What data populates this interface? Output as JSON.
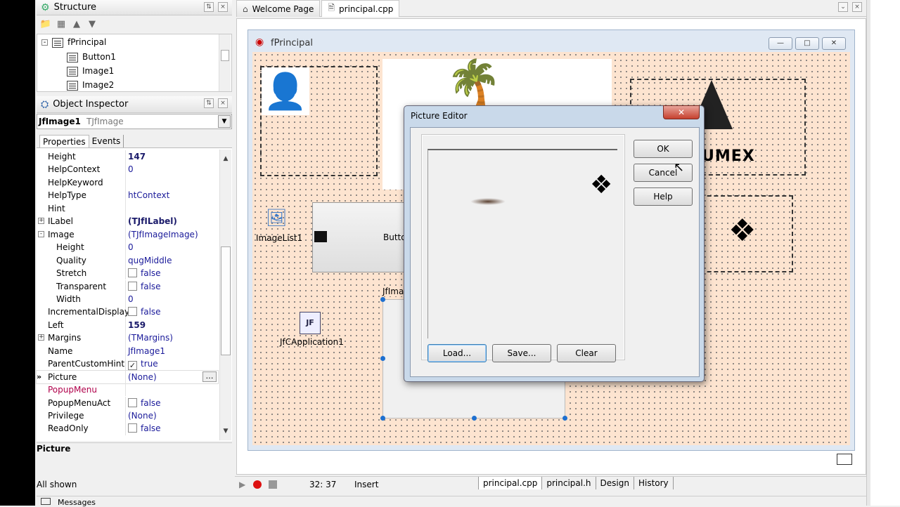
{
  "structure_panel": {
    "title": "Structure",
    "tree": [
      {
        "label": "fPrincipal",
        "level": 0
      },
      {
        "label": "Button1",
        "level": 1
      },
      {
        "label": "Image1",
        "level": 1
      },
      {
        "label": "Image2",
        "level": 1
      }
    ]
  },
  "inspector": {
    "title": "Object Inspector",
    "selected_name": "JfImage1",
    "selected_type": "TJfImage",
    "tabs": [
      "Properties",
      "Events"
    ],
    "rows": [
      {
        "name": "Height",
        "value": "147",
        "bold": true
      },
      {
        "name": "HelpContext",
        "value": "0"
      },
      {
        "name": "HelpKeyword",
        "value": ""
      },
      {
        "name": "HelpType",
        "value": "htContext"
      },
      {
        "name": "Hint",
        "value": ""
      },
      {
        "name": "ILabel",
        "value": "(TJfILabel)",
        "bold": true,
        "expand": "+"
      },
      {
        "name": "Image",
        "value": "(TJfImageImage)",
        "expand": "-"
      },
      {
        "name": "Height",
        "value": "0",
        "indent": true
      },
      {
        "name": "Quality",
        "value": "qugMiddle",
        "indent": true
      },
      {
        "name": "Stretch",
        "value": "false",
        "indent": true,
        "checkbox": true
      },
      {
        "name": "Transparent",
        "value": "false",
        "indent": true,
        "checkbox": true
      },
      {
        "name": "Width",
        "value": "0",
        "indent": true
      },
      {
        "name": "IncrementalDisplay",
        "value": "false",
        "checkbox": true
      },
      {
        "name": "Left",
        "value": "159",
        "bold": true
      },
      {
        "name": "Margins",
        "value": "(TMargins)",
        "expand": "+"
      },
      {
        "name": "Name",
        "value": "JfImage1"
      },
      {
        "name": "ParentCustomHint",
        "value": "true",
        "checkbox": true,
        "checked": true
      },
      {
        "name": "Picture",
        "value": "(None)",
        "selected": true
      },
      {
        "name": "PopupMenu",
        "value": "",
        "red": true
      },
      {
        "name": "PopupMenuAct",
        "value": "false",
        "checkbox": true
      },
      {
        "name": "Privilege",
        "value": "(None)"
      },
      {
        "name": "ReadOnly",
        "value": "false",
        "checkbox": true
      }
    ],
    "description": "Picture",
    "footer": "All shown"
  },
  "doc_tabs": [
    "Welcome Page",
    "principal.cpp"
  ],
  "form": {
    "caption": "fPrincipal",
    "components": {
      "imagelist_label": "ImageList1",
      "application_label": "JfCApplication1",
      "button_label": "Butto",
      "image_label": "JfIma",
      "logo_text": "UMEX"
    }
  },
  "dialog": {
    "title": "Picture Editor",
    "buttons": {
      "ok": "OK",
      "cancel": "Cancel",
      "help": "Help",
      "load": "Load...",
      "save": "Save...",
      "clear": "Clear"
    }
  },
  "status": {
    "position": "32: 37",
    "mode": "Insert",
    "bottom_tabs": [
      "principal.cpp",
      "principal.h",
      "Design",
      "History"
    ],
    "messages": "Messages"
  },
  "colors": {
    "form_bg": "#fde4d0",
    "accent": "#1e70d0"
  }
}
